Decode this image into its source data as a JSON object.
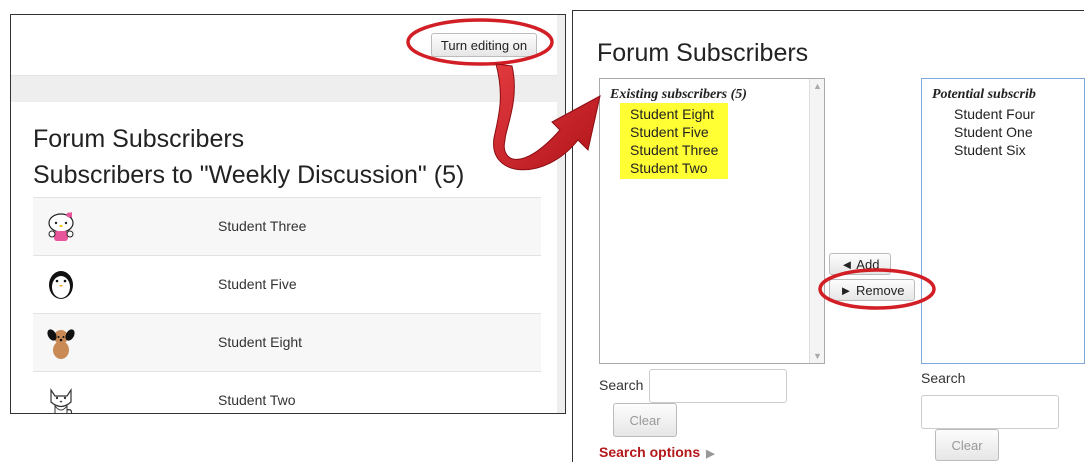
{
  "left": {
    "toolbar_button": "Turn editing on",
    "title": "Forum Subscribers",
    "subtitle": "Subscribers to \"Weekly Discussion\" (5)",
    "subscribers": [
      {
        "name": "Student Three",
        "avatar": "hello-kitty-avatar"
      },
      {
        "name": "Student Five",
        "avatar": "penguin-avatar"
      },
      {
        "name": "Student Eight",
        "avatar": "puppy-avatar"
      },
      {
        "name": "Student Two",
        "avatar": "cat-avatar"
      }
    ]
  },
  "right": {
    "title": "Forum Subscribers",
    "existing": {
      "label": "Existing subscribers (5)",
      "options": [
        "Student Eight",
        "Student Five",
        "Student Three",
        "Student Two"
      ]
    },
    "potential": {
      "label": "Potential subscrib",
      "options": [
        "Student Four",
        "Student One",
        "Student Six"
      ]
    },
    "add_label": "◄ Add",
    "remove_label": "► Remove",
    "search_label": "Search",
    "clear_label": "Clear",
    "search_options": "Search options"
  },
  "colors": {
    "annotation_red": "#d21f26",
    "highlight_yellow": "#ffff33",
    "search_options_red": "#b3181b"
  }
}
